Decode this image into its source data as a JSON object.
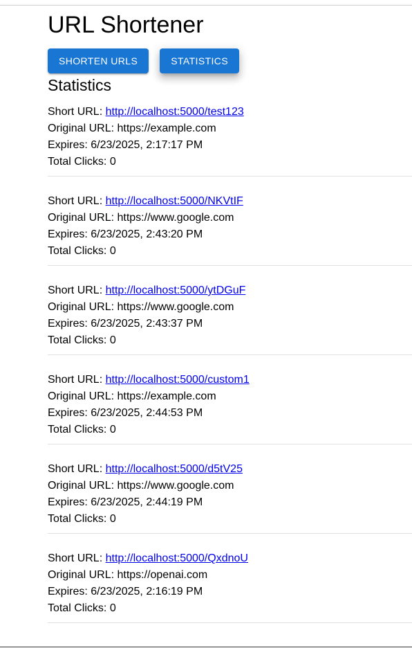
{
  "app": {
    "title": "URL Shortener"
  },
  "nav": {
    "shorten_label": "SHORTEN URLS",
    "statistics_label": "STATISTICS"
  },
  "stats": {
    "heading": "Statistics",
    "short_label": "Short URL:",
    "original_label": "Original URL:",
    "expires_label": "Expires:",
    "clicks_label": "Total Clicks:",
    "items": [
      {
        "short_url": "http://localhost:5000/test123",
        "original_url": "https://example.com",
        "expires": "6/23/2025, 2:17:17 PM",
        "clicks": "0"
      },
      {
        "short_url": "http://localhost:5000/NKVtIF",
        "original_url": "https://www.google.com",
        "expires": "6/23/2025, 2:43:20 PM",
        "clicks": "0"
      },
      {
        "short_url": "http://localhost:5000/ytDGuF",
        "original_url": "https://www.google.com",
        "expires": "6/23/2025, 2:43:37 PM",
        "clicks": "0"
      },
      {
        "short_url": "http://localhost:5000/custom1",
        "original_url": "https://example.com",
        "expires": "6/23/2025, 2:44:53 PM",
        "clicks": "0"
      },
      {
        "short_url": "http://localhost:5000/d5tV25",
        "original_url": "https://www.google.com",
        "expires": "6/23/2025, 2:44:19 PM",
        "clicks": "0"
      },
      {
        "short_url": "http://localhost:5000/QxdnoU",
        "original_url": "https://openai.com",
        "expires": "6/23/2025, 2:16:19 PM",
        "clicks": "0"
      }
    ]
  },
  "colors": {
    "primary": "#1976d2",
    "link": "#0000ee",
    "divider": "#e0e0e0"
  }
}
